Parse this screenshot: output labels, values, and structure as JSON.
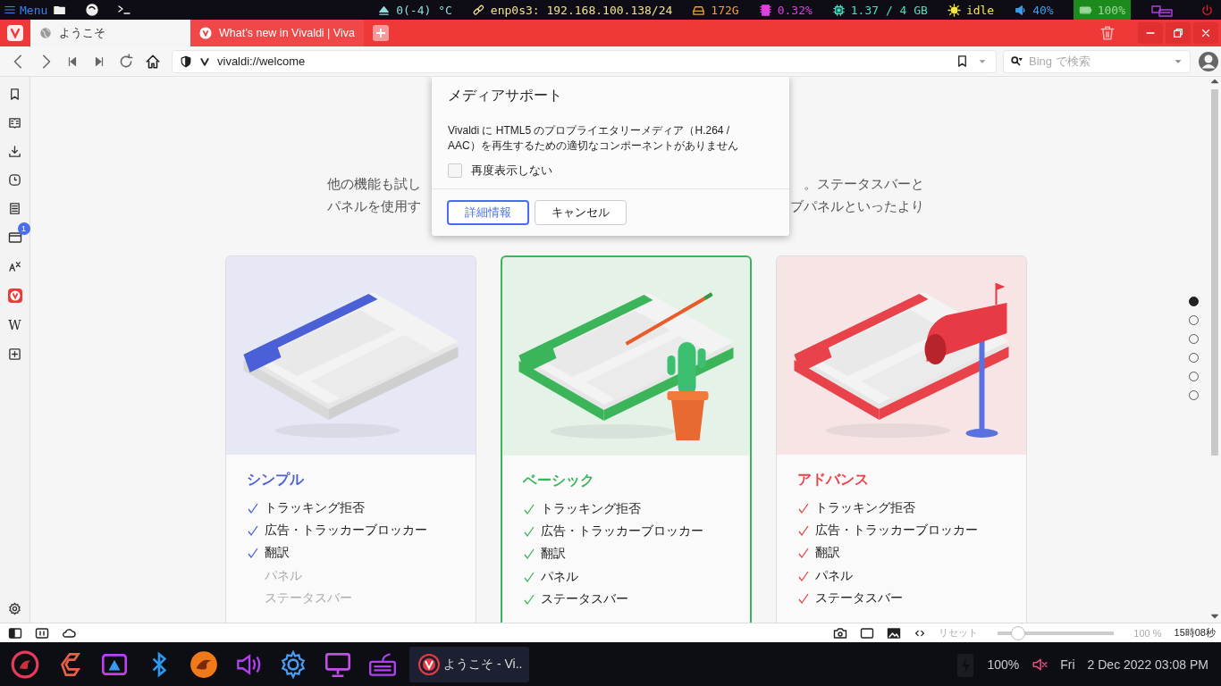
{
  "topbar": {
    "menu": "Menu",
    "status": [
      {
        "text": "0(-4) °C",
        "color": "#8fdcdc",
        "highlight": false
      },
      {
        "text": "enp0s3: 192.168.100.138/24",
        "color": "#f0e08a",
        "highlight": false
      },
      {
        "text": "172G",
        "color": "#f0a030",
        "highlight": false
      },
      {
        "text": "0.32%",
        "color": "#e040e0",
        "highlight": false
      },
      {
        "text": "1.37 / 4 GB",
        "color": "#40e0c0",
        "highlight": false
      },
      {
        "text": "idle",
        "color": "#f5e640",
        "highlight": false
      },
      {
        "text": "40%",
        "color": "#3a9ee8",
        "highlight": false
      },
      {
        "text": "100%",
        "color": "#9ad89a",
        "highlight": true
      }
    ]
  },
  "tabs": [
    {
      "title": "ようこそ",
      "selected": true
    },
    {
      "title": "What’s new in Vivaldi | Viva",
      "selected": false
    }
  ],
  "address": {
    "url": "vivaldi://welcome"
  },
  "search": {
    "placeholder": "Bing で検索"
  },
  "sidebar": {
    "badge": "1",
    "wiki": "W"
  },
  "intro": [
    {
      "left": "他の機能も試し",
      "right": "。ステータスバーと"
    },
    {
      "left": "パネルを使用す",
      "right": "ブパネルといったより"
    }
  ],
  "dialog": {
    "title": "メディアサポート",
    "message": "Vivaldi に HTML5 のプロプライエタリーメディア（H.264 / AAC）を再生するための適切なコンポーネントがありません",
    "checkbox": {
      "label": "再度表示しない",
      "checked": false
    },
    "buttons": [
      {
        "label": "詳細情報",
        "primary": true
      },
      {
        "label": "キャンセル",
        "primary": false
      }
    ]
  },
  "cards": [
    {
      "title": "シンプル",
      "color": "#4b5fd6",
      "selected": false,
      "features": [
        {
          "label": "トラッキング拒否",
          "included": true
        },
        {
          "label": "広告・トラッカーブロッカー",
          "included": true
        },
        {
          "label": "翻訳",
          "included": true
        },
        {
          "label": "パネル",
          "included": false
        },
        {
          "label": "ステータスバー",
          "included": false
        }
      ]
    },
    {
      "title": "ベーシック",
      "color": "#3cb55a",
      "selected": true,
      "features": [
        {
          "label": "トラッキング拒否",
          "included": true
        },
        {
          "label": "広告・トラッカーブロッカー",
          "included": true
        },
        {
          "label": "翻訳",
          "included": true
        },
        {
          "label": "パネル",
          "included": true
        },
        {
          "label": "ステータスバー",
          "included": true
        }
      ]
    },
    {
      "title": "アドバンス",
      "color": "#e8434a",
      "selected": false,
      "features": [
        {
          "label": "トラッキング拒否",
          "included": true
        },
        {
          "label": "広告・トラッカーブロッカー",
          "included": true
        },
        {
          "label": "翻訳",
          "included": true
        },
        {
          "label": "パネル",
          "included": true
        },
        {
          "label": "ステータスバー",
          "included": true
        }
      ]
    }
  ],
  "page_dots": [
    {
      "selected": true
    },
    {
      "selected": false
    },
    {
      "selected": false
    },
    {
      "selected": false
    },
    {
      "selected": false
    },
    {
      "selected": false
    }
  ],
  "statusbar": {
    "reset": "リセット",
    "zoom": {
      "level": 0.21
    },
    "zoom_reading": "100 %",
    "clock": "15時08秒"
  },
  "taskbar": {
    "task": "ようこそ - Vi..",
    "battery": "100%",
    "day": "Fri",
    "datetime": "2 Dec 2022 03:08 PM"
  }
}
